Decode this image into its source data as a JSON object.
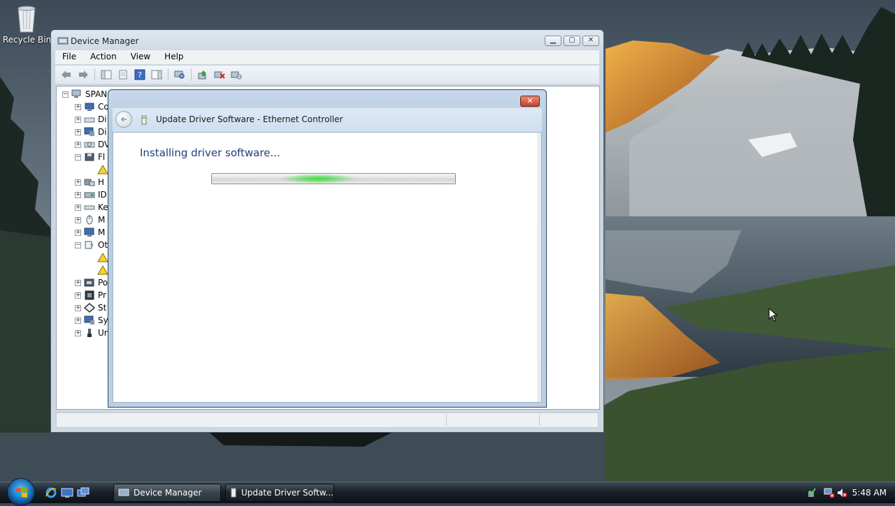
{
  "desktop": {
    "recycle_bin_label": "Recycle Bin"
  },
  "device_manager": {
    "title": "Device Manager",
    "menu": [
      "File",
      "Action",
      "View",
      "Help"
    ],
    "toolbar_icons": [
      "back-icon",
      "forward-icon",
      "show-hide-console-tree-icon",
      "properties-icon",
      "help-icon",
      "show-action-pane-icon",
      "scan-hardware-icon",
      "update-driver-icon",
      "uninstall-icon",
      "disable-icon"
    ],
    "tree": {
      "root": "SPAN",
      "nodes": [
        "Co",
        "Di",
        "Di",
        "DV",
        "Fl",
        "",
        "H",
        "ID",
        "Ke",
        "M",
        "M",
        "Ot",
        "",
        "",
        "Po",
        "Pr",
        "St",
        "Sy",
        "Ur"
      ]
    }
  },
  "update_driver_dialog": {
    "title": "Update Driver Software - Ethernet Controller",
    "heading": "Installing driver software...",
    "close_label": "✕"
  },
  "taskbar": {
    "buttons": [
      "Device Manager",
      "Update Driver Softw..."
    ],
    "clock": "5:48 AM"
  },
  "colors": {
    "heading_blue": "#1f3e7b",
    "progress_glow": "#3ee23a",
    "taskbar_dark": "#1a2129"
  }
}
